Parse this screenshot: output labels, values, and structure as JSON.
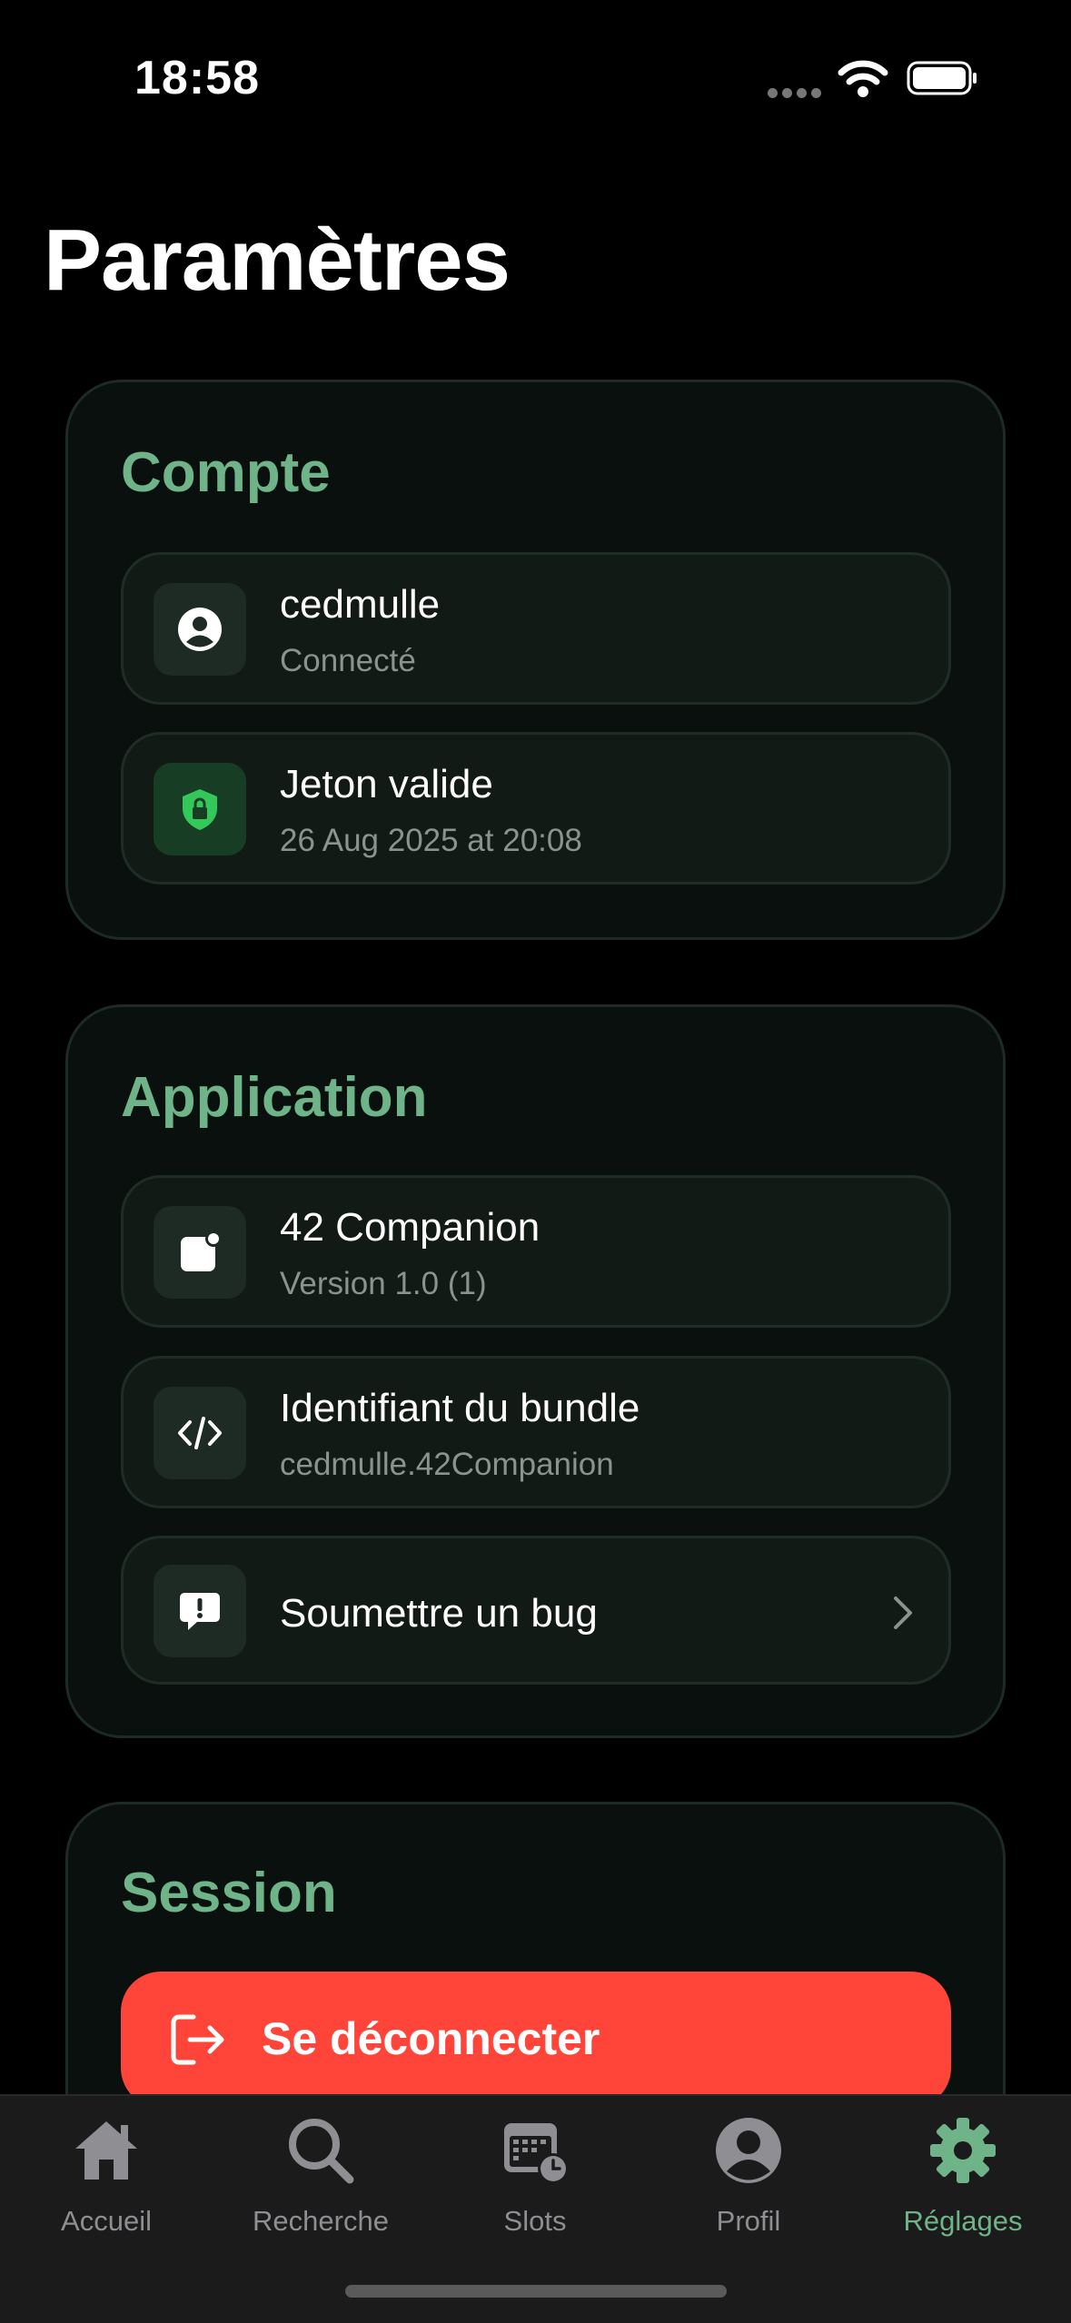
{
  "status": {
    "time": "18:58"
  },
  "page": {
    "title": "Paramètres"
  },
  "account": {
    "title": "Compte",
    "user": {
      "name": "cedmulle",
      "status": "Connecté"
    },
    "token": {
      "title": "Jeton valide",
      "date": "26 Aug 2025 at 20:08"
    }
  },
  "application": {
    "title": "Application",
    "app": {
      "name": "42 Companion",
      "version": "Version 1.0 (1)"
    },
    "bundle": {
      "title": "Identifiant du bundle",
      "value": "cedmulle.42Companion"
    },
    "bug": {
      "label": "Soumettre un bug"
    }
  },
  "session": {
    "title": "Session",
    "logout_label": "Se déconnecter"
  },
  "tabs": [
    {
      "label": "Accueil",
      "icon": "house-icon"
    },
    {
      "label": "Recherche",
      "icon": "magnifier-icon"
    },
    {
      "label": "Slots",
      "icon": "calendar-clock-icon"
    },
    {
      "label": "Profil",
      "icon": "person-circle-icon"
    },
    {
      "label": "Réglages",
      "icon": "gear-icon",
      "active": true
    }
  ],
  "colors": {
    "accent": "#6fb388",
    "danger": "#ff453a",
    "background": "#000000"
  }
}
